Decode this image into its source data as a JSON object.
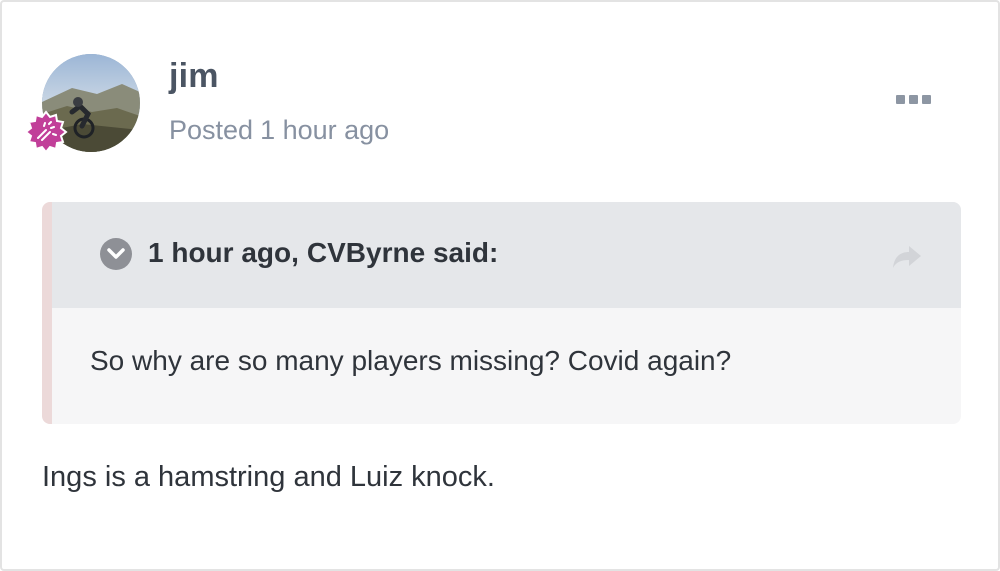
{
  "author": {
    "name": "jim",
    "posted_prefix": "Posted",
    "posted_time": "1 hour ago",
    "avatar_icon": "avatar-photo-cyclist",
    "badge_icon": "rank-badge-icon",
    "badge_color": "#c13f99"
  },
  "menu": {
    "more_icon": "ellipsis-icon"
  },
  "quote": {
    "citation_time": "1 hour ago,",
    "citation_author": "CVByrne said:",
    "toggle_icon": "chevron-down-icon",
    "link_icon": "share-arrow-icon",
    "body": "So why are so many players missing? Covid again?"
  },
  "post": {
    "body": "Ings is a hamstring and Luiz knock."
  },
  "colors": {
    "quote_header_bg": "#e5e7ea",
    "quote_body_bg": "#f6f6f7",
    "quote_border": "#ecd9d9",
    "meta_text": "#8791a1"
  }
}
